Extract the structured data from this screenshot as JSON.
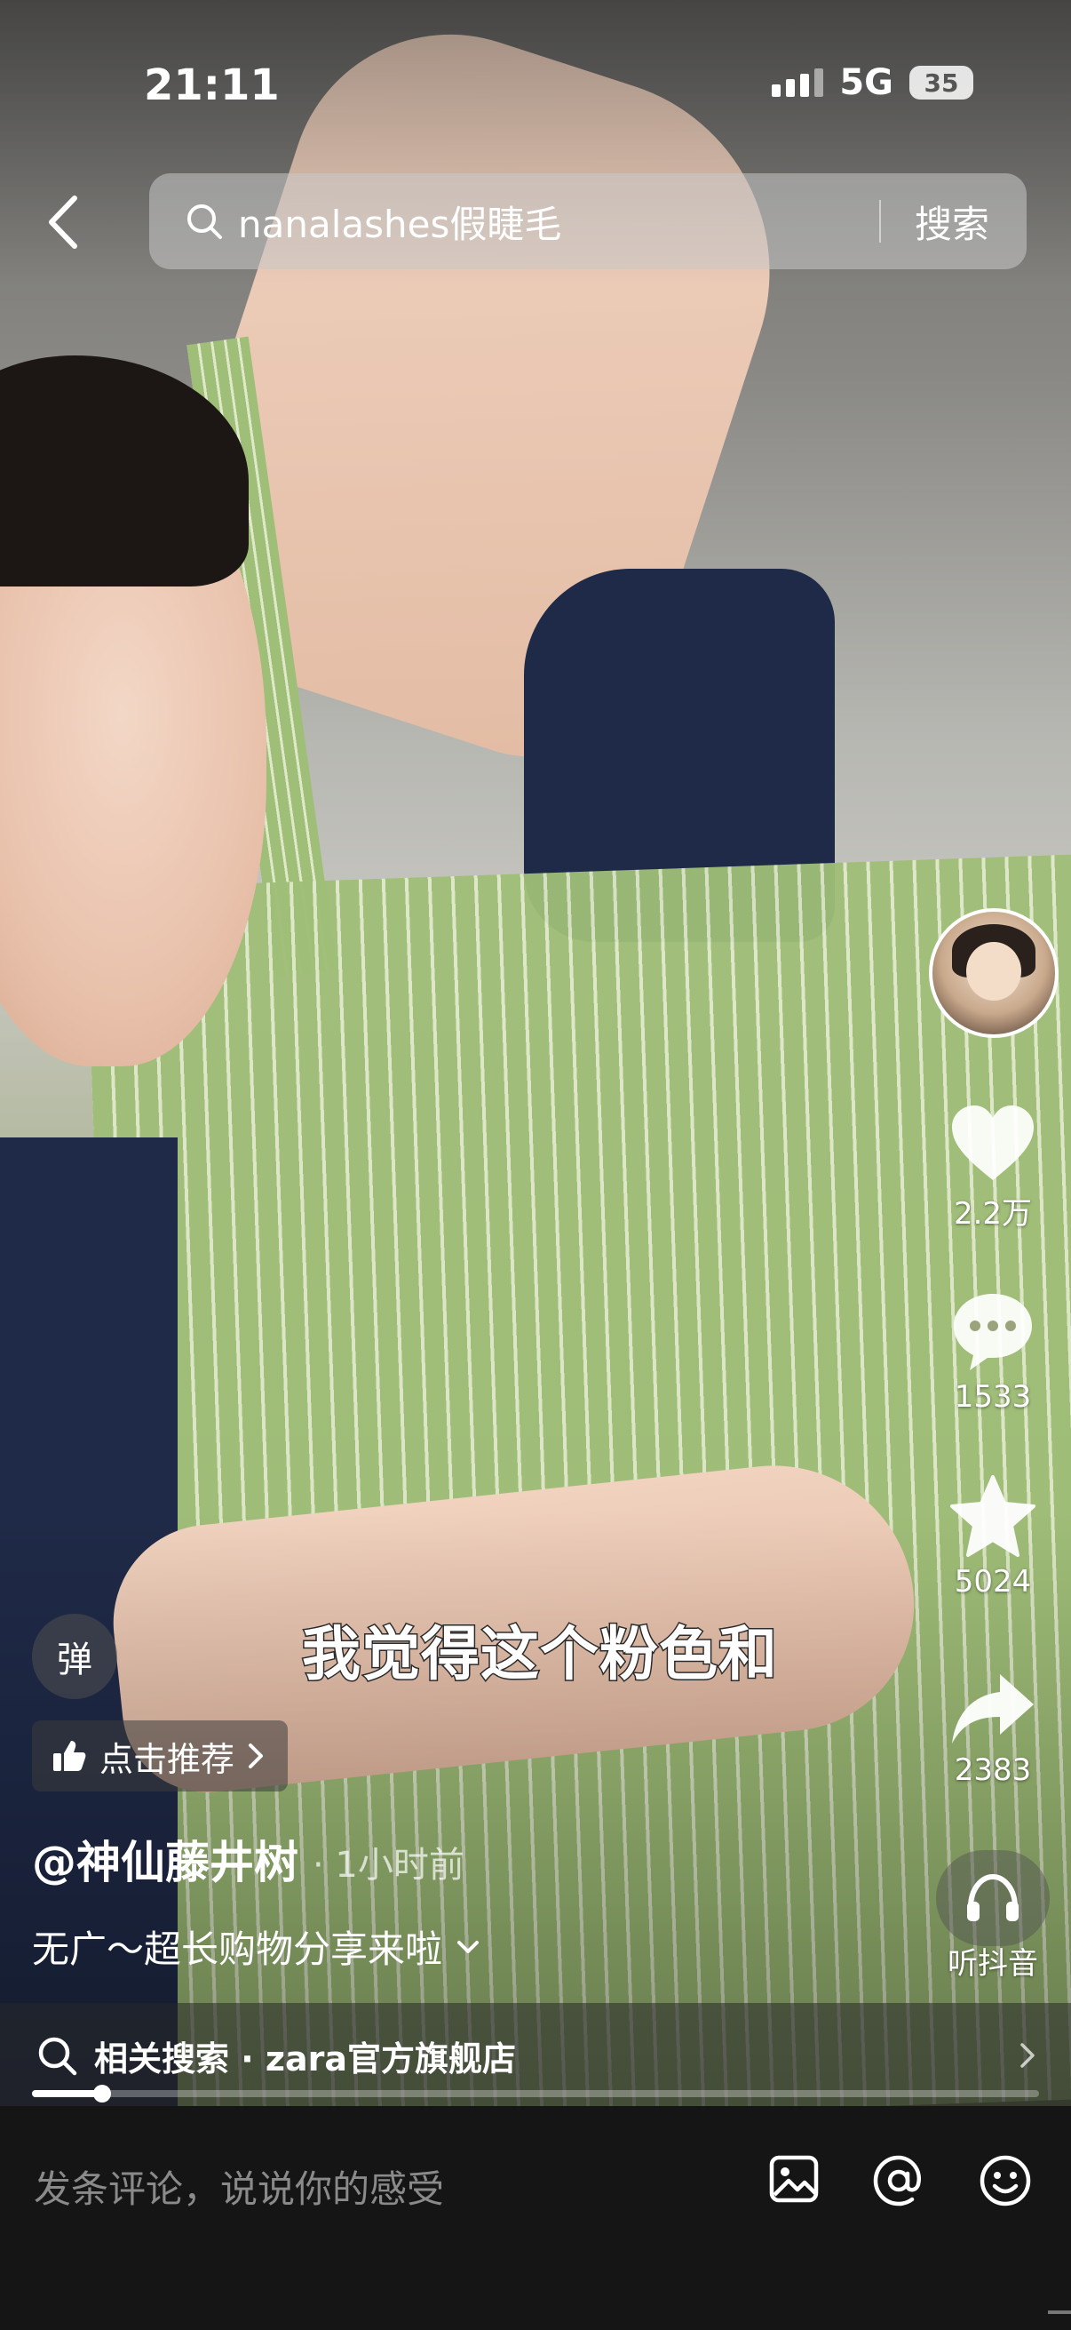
{
  "status_bar": {
    "time": "21:11",
    "network": "5G",
    "battery": "35"
  },
  "search": {
    "query": "nanalashes假睫毛",
    "button_label": "搜索"
  },
  "rail": {
    "likes": "2.2万",
    "comments": "1533",
    "favorites": "5024",
    "shares": "2383",
    "listen_label": "听抖音"
  },
  "video": {
    "subtitle": "我觉得这个粉色和",
    "danmu_label": "弹",
    "recommend_label": "点击推荐",
    "author": "@神仙藤井树",
    "time_ago": "· 1小时前",
    "description": "无广～超长购物分享来啦",
    "progress": 0.07
  },
  "related": {
    "label": "相关搜索 · zara官方旗舰店"
  },
  "comment_bar": {
    "placeholder": "发条评论，说说你的感受"
  },
  "icons": [
    "back-icon",
    "search-icon",
    "heart-icon",
    "comment-icon",
    "star-icon",
    "share-icon",
    "headphones-icon",
    "thumb-up-icon",
    "chevron-right-icon",
    "chevron-down-icon",
    "image-icon",
    "at-icon",
    "emoji-icon"
  ]
}
